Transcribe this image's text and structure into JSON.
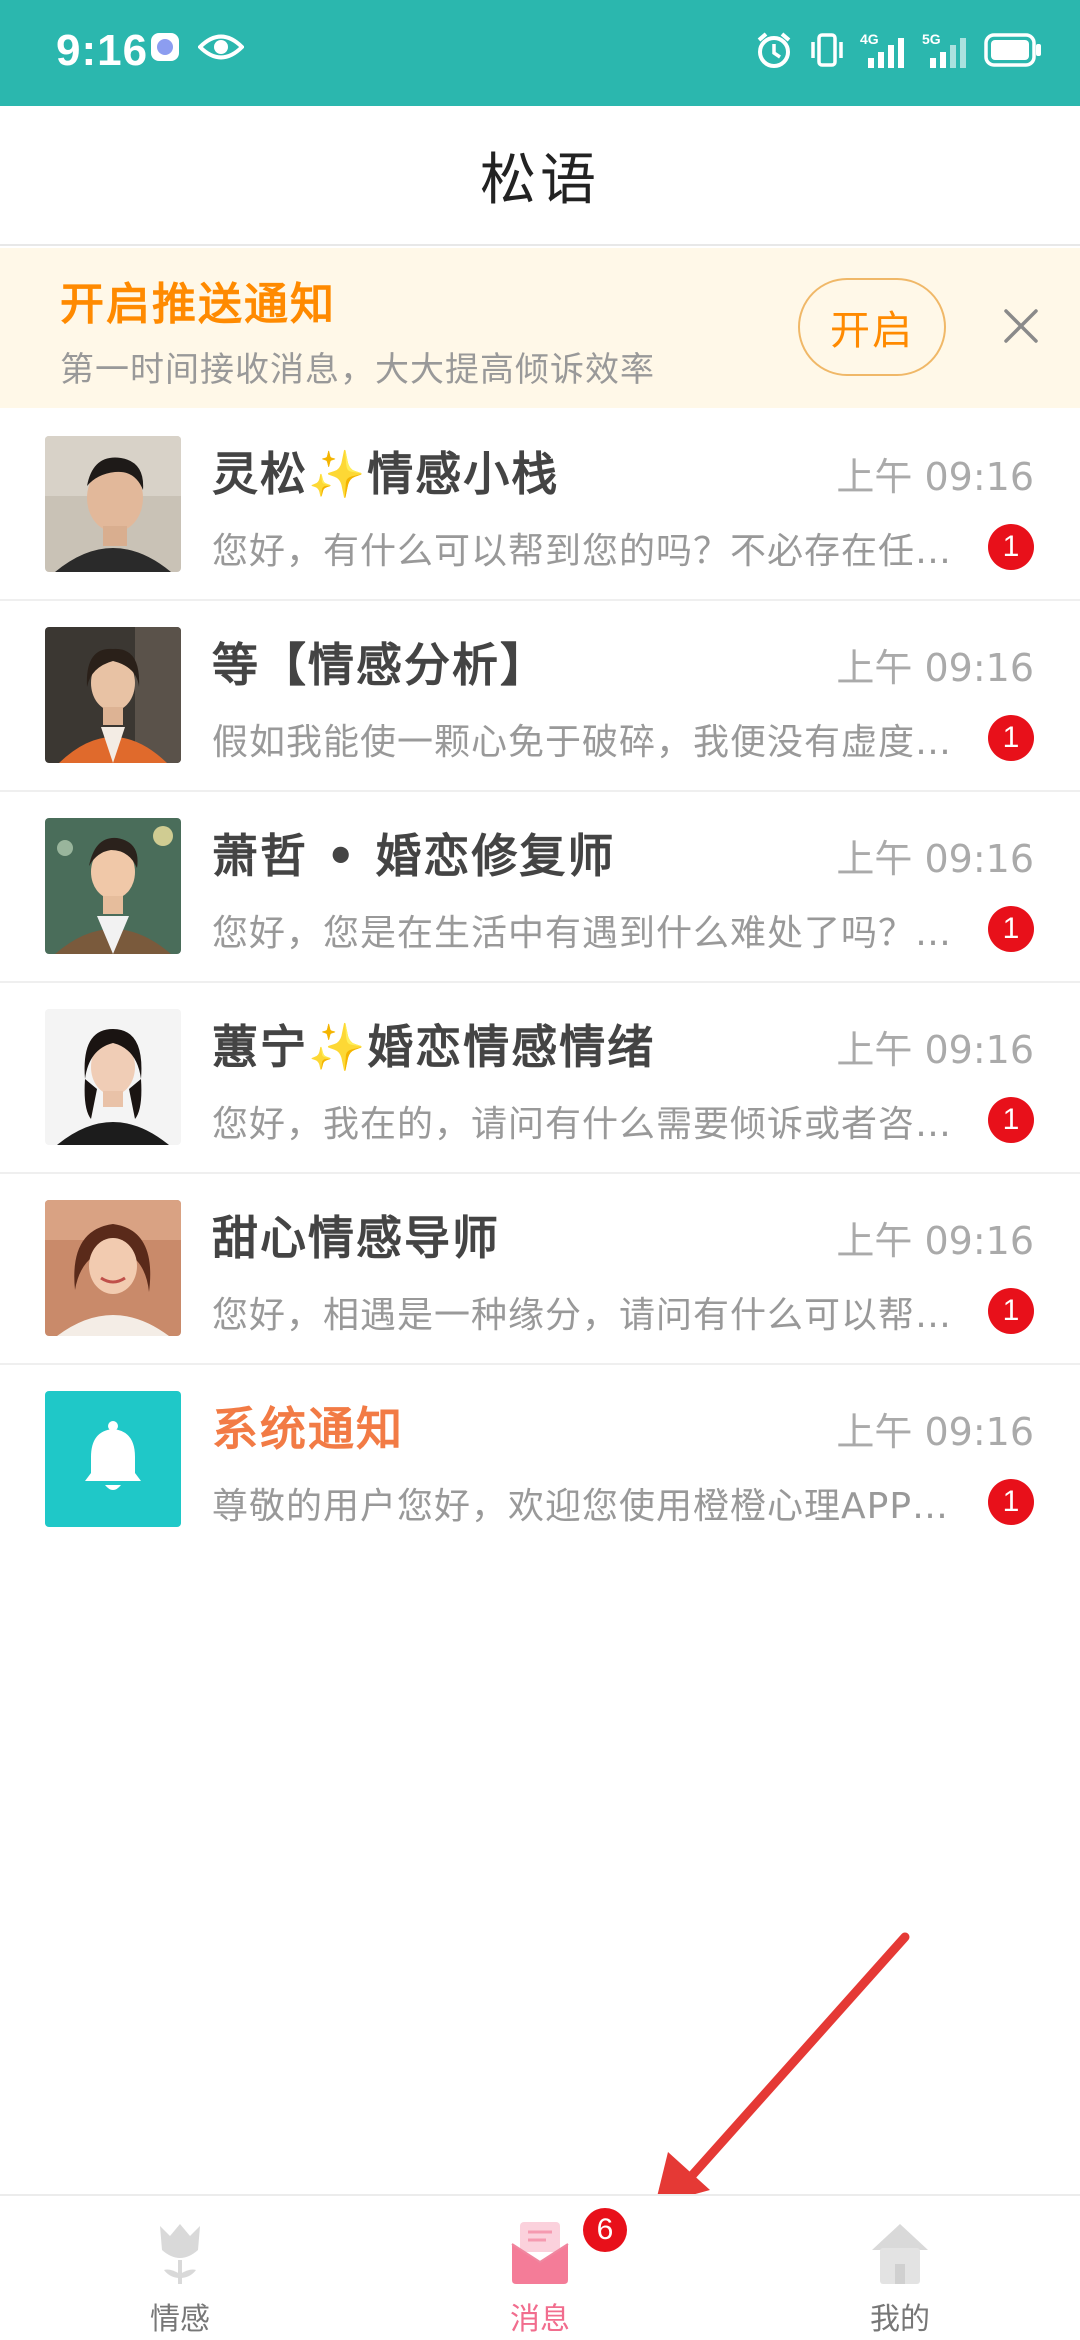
{
  "status_bar": {
    "time": "9:16",
    "left_icons": [
      "app-notification-icon",
      "eye-icon"
    ],
    "right_icons": [
      "alarm-icon",
      "vibrate-icon",
      "signal-4g-icon",
      "signal-5g-icon",
      "battery-icon"
    ],
    "network_labels": [
      "4G",
      "5G"
    ],
    "color": "#2bb7ae"
  },
  "header": {
    "title": "松语"
  },
  "push_banner": {
    "title": "开启推送通知",
    "subtitle": "第一时间接收消息，大大提高倾诉效率",
    "open_label": "开启",
    "close_icon": "close-icon"
  },
  "messages": [
    {
      "name": "灵松✨情感小栈",
      "time": "上午 09:16",
      "preview": "您好，有什么可以帮到您的吗？不必存在任何顾虑，请放心与我倾诉。",
      "unread": "1"
    },
    {
      "name": "等【情感分析】",
      "time": "上午 09:16",
      "preview": "假如我能使一颗心免于破碎，我便没有虚度此生。",
      "unread": "1"
    },
    {
      "name": "萧哲 • 婚恋修复师",
      "time": "上午 09:16",
      "preview": "您好，您是在生活中有遇到什么难处了吗？可以和我说说。",
      "unread": "1"
    },
    {
      "name": "蕙宁✨婚恋情感情绪",
      "time": "上午 09:16",
      "preview": "您好，我在的，请问有什么需要倾诉或者咨询的吗？",
      "unread": "1"
    },
    {
      "name": "甜心情感导师",
      "time": "上午 09:16",
      "preview": "您好，相遇是一种缘分，请问有什么可以帮助您的吗？",
      "unread": "1"
    },
    {
      "name": "系统通知",
      "time": "上午 09:16",
      "preview": "尊敬的用户您好，欢迎您使用橙橙心理APP，祝您生活愉快。",
      "unread": "1"
    }
  ],
  "tab_bar": {
    "tabs": [
      {
        "label": "情感",
        "icon": "tulip-icon",
        "active": false
      },
      {
        "label": "消息",
        "icon": "message-envelope-icon",
        "active": true,
        "badge": "6"
      },
      {
        "label": "我的",
        "icon": "home-icon",
        "active": false
      }
    ]
  },
  "colors": {
    "accent": "#2bb7ae",
    "push_title": "#ff8a00",
    "system_name": "#f27b45",
    "badge": "#e8101a",
    "active_tab": "#f16d8e",
    "annotation_arrow": "#e53935"
  }
}
